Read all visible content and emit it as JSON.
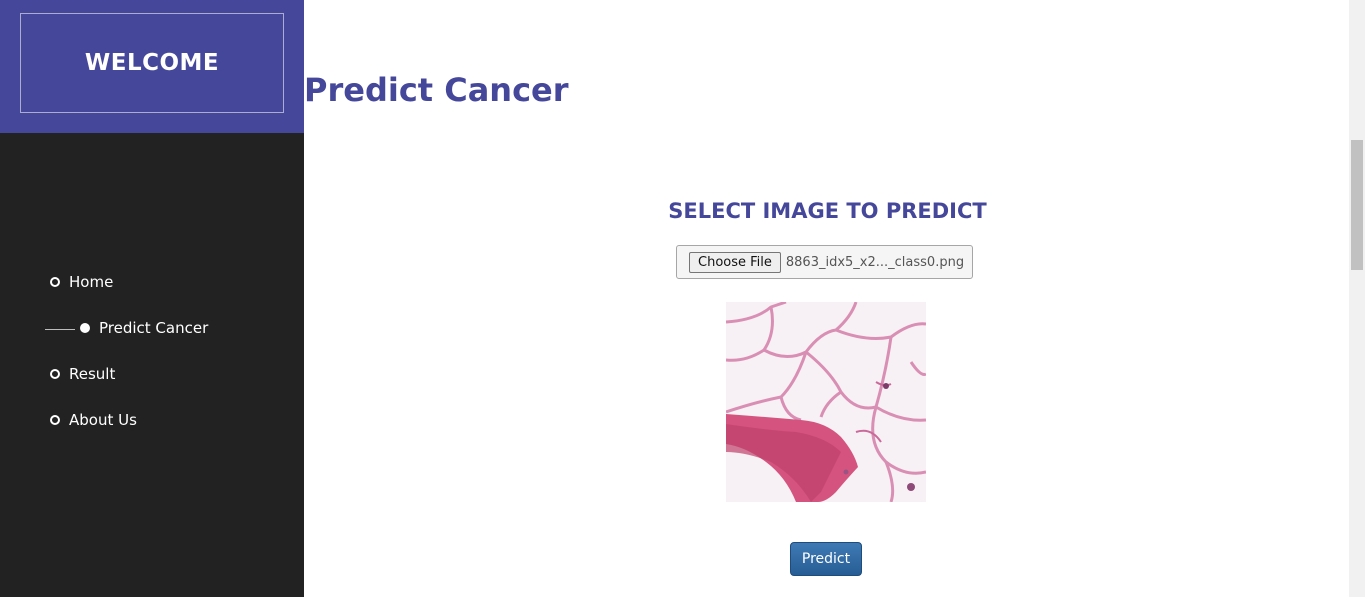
{
  "sidebar": {
    "brand": "WELCOME",
    "items": [
      {
        "label": "Home",
        "active": false
      },
      {
        "label": "Predict Cancer",
        "active": true
      },
      {
        "label": "Result",
        "active": false
      },
      {
        "label": "About Us",
        "active": false
      }
    ]
  },
  "main": {
    "title": "Predict Cancer",
    "select_heading": "SELECT IMAGE TO PREDICT",
    "file_button_label": "Choose File",
    "file_name": "8863_idx5_x2..._class0.png",
    "predict_label": "Predict"
  },
  "colors": {
    "brand": "#45479a",
    "sidebar_bg": "#222222",
    "button": "#275d95"
  }
}
